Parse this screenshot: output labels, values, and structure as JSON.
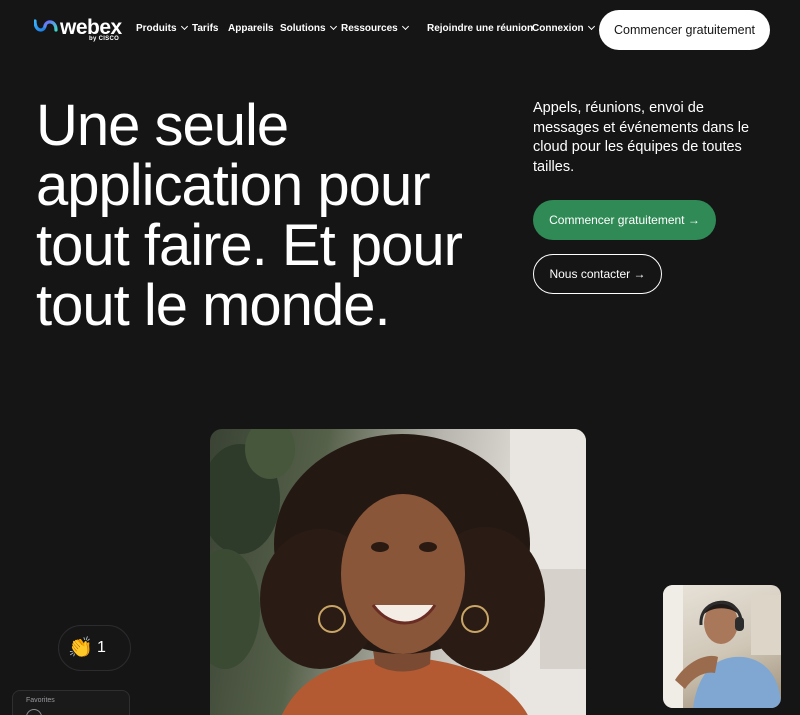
{
  "brand": {
    "name": "webex",
    "sub": "by CISCO"
  },
  "nav": {
    "items": [
      {
        "label": "Produits",
        "dropdown": true
      },
      {
        "label": "Tarifs",
        "dropdown": false
      },
      {
        "label": "Appareils",
        "dropdown": false
      },
      {
        "label": "Solutions",
        "dropdown": true
      },
      {
        "label": "Ressources",
        "dropdown": true
      }
    ],
    "join": "Rejoindre une réunion",
    "login": "Connexion",
    "cta": "Commencer gratuitement"
  },
  "hero": {
    "title": "Une seule application pour tout faire. Et pour tout le monde.",
    "description": "Appels, réunions, envoi de messages et événements dans le cloud pour les équipes de toutes tailles.",
    "primary_cta": "Commencer gratuitement →",
    "secondary_cta": "Nous contacter →"
  },
  "reaction": {
    "emoji": "👏",
    "count": "1"
  },
  "favorites": {
    "label": "Favorites"
  },
  "colors": {
    "background": "#151516",
    "accent_green": "#2f8a55",
    "white": "#ffffff"
  }
}
